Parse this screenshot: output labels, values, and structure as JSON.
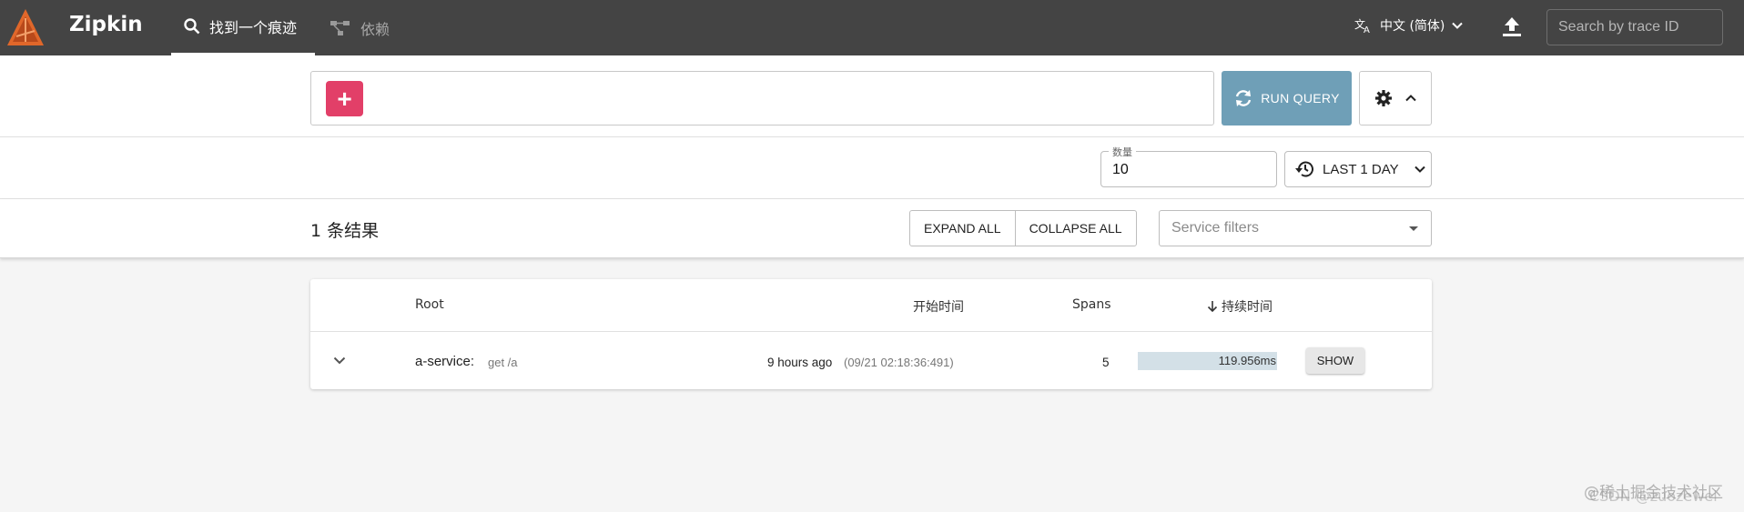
{
  "header": {
    "brand": "Zipkin",
    "nav": [
      {
        "label": "找到一个痕迹",
        "icon": "search-icon",
        "active": true
      },
      {
        "label": "依赖",
        "icon": "dependency-graph-icon",
        "active": false
      }
    ],
    "language": "中文 (简体)",
    "trace_search_placeholder": "Search by trace ID"
  },
  "query": {
    "add_label": "+",
    "run_label": "RUN QUERY"
  },
  "filters": {
    "limit_label": "数量",
    "limit_value": "10",
    "lookback_label": "LAST 1 DAY"
  },
  "results": {
    "count_label": "1 条结果",
    "expand_all": "EXPAND ALL",
    "collapse_all": "COLLAPSE ALL",
    "service_filter_placeholder": "Service filters"
  },
  "table": {
    "columns": {
      "root": "Root",
      "start_time": "开始时间",
      "spans": "Spans",
      "duration": "持续时间"
    },
    "rows": [
      {
        "service": "a-service:",
        "span_name": "get /a",
        "relative_time": "9 hours ago",
        "timestamp": "(09/21 02:18:36:491)",
        "spans": "5",
        "duration": "119.956ms",
        "show_label": "SHOW"
      }
    ]
  },
  "watermark": {
    "line1": "@稀土掘金技术社区",
    "line2": "CSDN @zuozewei"
  },
  "colors": {
    "topbar": "#444444",
    "accent": "#e23f68",
    "run_button": "#6f9fb7",
    "duration_bar": "#d3e0e7"
  }
}
